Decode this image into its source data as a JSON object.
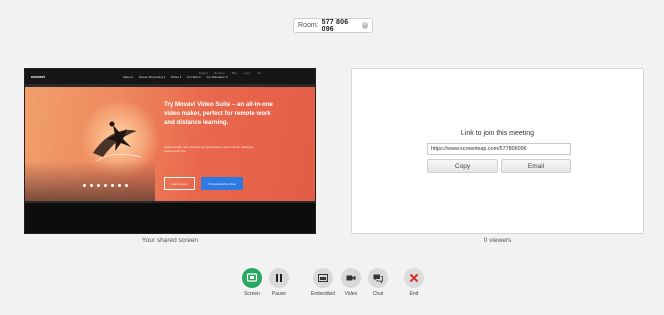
{
  "room": {
    "label": "Room:",
    "number": "577 806 096",
    "close_icon": "close-circle-icon"
  },
  "preview": {
    "site_logo": "movavi",
    "site_top_links": [
      "Support",
      "Business",
      "Blog",
      "Log in",
      "EN"
    ],
    "site_menu": [
      "Video ▾",
      "Screen Recording ▾",
      "Photo ▾",
      "For Mac ▾",
      "For Education ▾"
    ],
    "hero_title": "Try Movavi Video Suite – an all-in-one video maker, perfect for remote work and distance learning.",
    "hero_sub": "Create tutorials, record lectures and presentations, share it all with colleagues, students and more.",
    "learn_more": "Learn more ›",
    "download": "⬇ Download for Free"
  },
  "join": {
    "title": "Link to join this meeting",
    "link": "https://www.screenleap.com/577806096",
    "copy_label": "Copy",
    "email_label": "Email"
  },
  "captions": {
    "shared": "Your shared screen",
    "viewers": "0 viewers"
  },
  "toolbar": [
    {
      "label": "Screen",
      "icon": "screen-share-icon",
      "color": "#28a760"
    },
    {
      "label": "Pause",
      "icon": "pause-icon"
    },
    {
      "label": "Embedded",
      "icon": "embedded-icon"
    },
    {
      "label": "Video",
      "icon": "video-camera-icon"
    },
    {
      "label": "Chat",
      "icon": "chat-bubble-icon"
    },
    {
      "label": "End",
      "icon": "end-x-icon",
      "color": "#d63434"
    }
  ]
}
